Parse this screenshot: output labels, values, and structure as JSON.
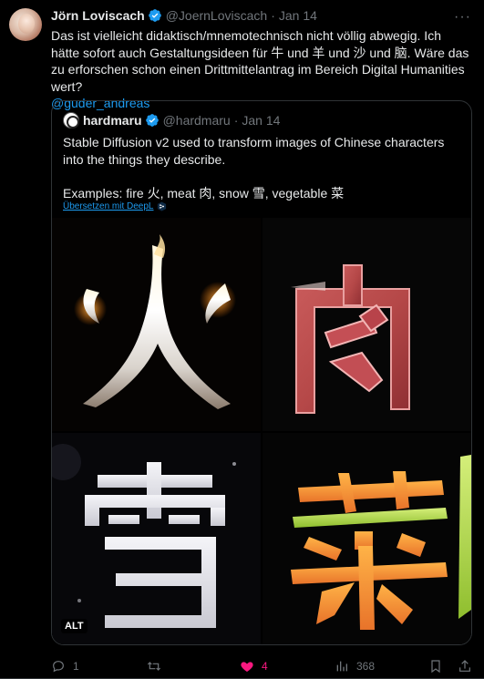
{
  "tweet": {
    "author_name": "Jörn Loviscach",
    "author_handle": "@JoernLoviscach",
    "separator": "·",
    "time": "Jan 14",
    "text": "Das ist vielleicht didaktisch/mnemotechnisch nicht völlig abwegig. Ich hätte sofort auch Gestaltungsideen für 牛 und 羊 und 沙 und 脑. Wäre das zu erforschen schon einen Drittmittelantrag im Bereich Digital Humanities wert?",
    "mention": "@guder_andreas"
  },
  "quote": {
    "author_name": "hardmaru",
    "author_handle": "@hardmaru",
    "separator": "·",
    "time": "Jan 14",
    "line1": "Stable Diffusion v2 used to transform images of Chinese characters into the things they describe.",
    "line2": "Examples: fire 火, meat 肉, snow 雪, vegetable 菜",
    "translate_label": "Übersetzen mit DeepL",
    "alt_badge": "ALT",
    "images": [
      {
        "char": "火",
        "label": "fire"
      },
      {
        "char": "肉",
        "label": "meat"
      },
      {
        "char": "雪",
        "label": "snow"
      },
      {
        "char": "菜",
        "label": "vegetable"
      }
    ]
  },
  "actions": {
    "reply_count": "1",
    "retweet_count": "",
    "like_count": "4",
    "views_count": "368"
  },
  "colors": {
    "background": "#000000",
    "text": "#e7e9ea",
    "secondary": "#71767b",
    "link": "#1d9bf0",
    "like": "#f91880",
    "border": "#2f3336"
  },
  "icons": [
    "verified-badge-icon",
    "more-icon",
    "reply-icon",
    "retweet-icon",
    "heart-icon",
    "views-icon",
    "bookmark-icon",
    "share-icon",
    "deepl-icon"
  ]
}
